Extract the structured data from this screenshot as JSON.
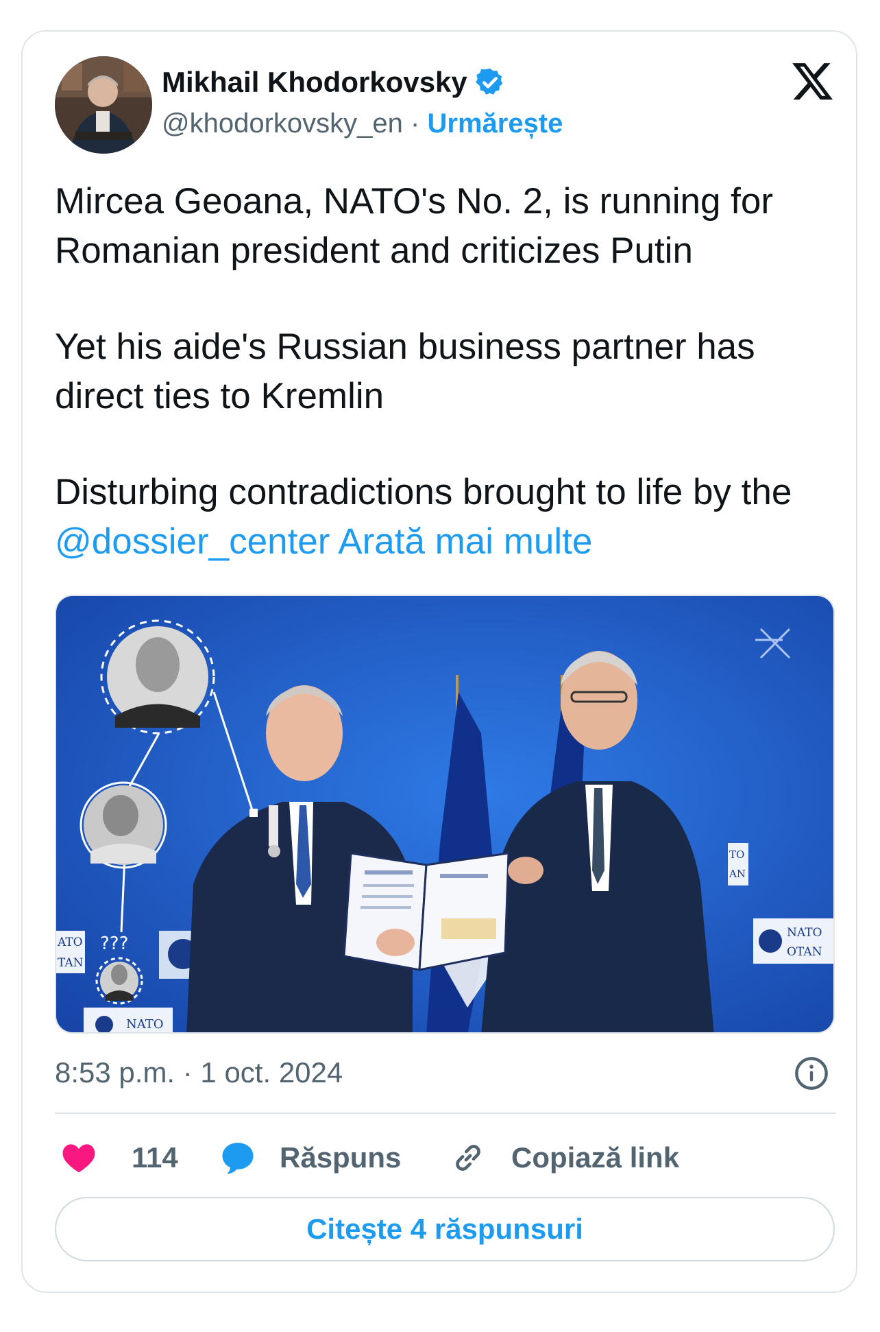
{
  "author": {
    "name": "Mikhail Khodorkovsky",
    "handle": "@khodorkovsky_en",
    "separator": "·",
    "follow_label": "Urmărește",
    "verified_icon": "verified-badge-icon"
  },
  "tweet": {
    "paragraph1": "Mircea Geoana, NATO's No. 2, is running for Romanian president and criticizes Putin",
    "paragraph2": "Yet his aide's Russian business partner has direct ties to Kremlin",
    "paragraph3_prefix": "Disturbing contradictions brought to life by the ",
    "mention": "@dossier_center",
    "show_more": "Arată mai multe"
  },
  "media": {
    "question_marks": "???",
    "nato_sign_left": "NATO",
    "otan_sign_left": "OTAN",
    "nato_sign_bottom": "NATO",
    "nato_sign_right": "NATO",
    "otan_sign_right": "OTAN",
    "ato_partial": "ATO",
    "tan_partial": "TAN",
    "to_partial": "TO",
    "an_partial": "AN"
  },
  "meta": {
    "timestamp": "8:53 p.m. · 1 oct. 2024"
  },
  "actions": {
    "likes_count": "114",
    "reply_label": "Răspuns",
    "copy_link_label": "Copiază link"
  },
  "footer": {
    "read_replies_label": "Citește 4 răspunsuri"
  },
  "colors": {
    "accent": "#1d9bf0",
    "like": "#f91880",
    "text": "#0f1419",
    "muted": "#536471",
    "media_bg": "#1f5fd0"
  }
}
